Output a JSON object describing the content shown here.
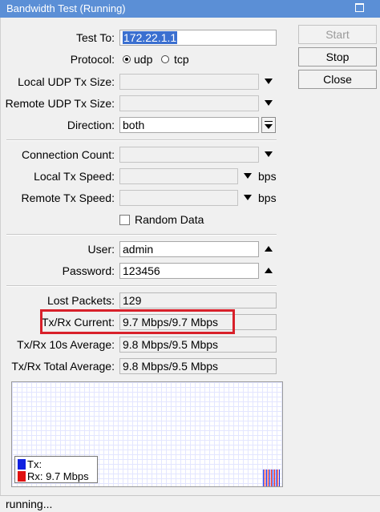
{
  "window": {
    "title": "Bandwidth Test (Running)"
  },
  "form": {
    "test_to": {
      "label": "Test To:",
      "value": "172.22.1.1"
    },
    "protocol": {
      "label": "Protocol:",
      "options": [
        "udp",
        "tcp"
      ],
      "selected": "udp"
    },
    "local_udp_tx_size": {
      "label": "Local UDP Tx Size:",
      "value": ""
    },
    "remote_udp_tx_size": {
      "label": "Remote UDP Tx Size:",
      "value": ""
    },
    "direction": {
      "label": "Direction:",
      "value": "both"
    },
    "connection_count": {
      "label": "Connection Count:",
      "value": ""
    },
    "local_tx_speed": {
      "label": "Local Tx Speed:",
      "value": "",
      "unit": "bps"
    },
    "remote_tx_speed": {
      "label": "Remote Tx Speed:",
      "value": "",
      "unit": "bps"
    },
    "random_data": {
      "label": "Random Data",
      "checked": false
    },
    "user": {
      "label": "User:",
      "value": "admin"
    },
    "password": {
      "label": "Password:",
      "value": "123456"
    }
  },
  "stats": {
    "lost_packets": {
      "label": "Lost Packets:",
      "value": "129"
    },
    "txrx_current": {
      "label": "Tx/Rx Current:",
      "value": "9.7 Mbps/9.7 Mbps"
    },
    "txrx_10s_avg": {
      "label": "Tx/Rx 10s Average:",
      "value": "9.8 Mbps/9.5 Mbps"
    },
    "txrx_total_avg": {
      "label": "Tx/Rx Total Average:",
      "value": "9.8 Mbps/9.5 Mbps"
    }
  },
  "buttons": {
    "start": "Start",
    "stop": "Stop",
    "close": "Close"
  },
  "graph": {
    "legend": [
      {
        "label": "Tx:",
        "color": "#1020e0"
      },
      {
        "label": "Rx:  9.7 Mbps",
        "color": "#e01010"
      }
    ],
    "bar_colors": [
      "#1020e0",
      "#e01010"
    ]
  },
  "status": {
    "text": "running..."
  },
  "icons": {
    "dropdown": "triangle-down-icon",
    "collapse": "triangle-up-icon",
    "direction_dropdown": "dropdown-box-icon",
    "maximize": "maximize-icon"
  }
}
